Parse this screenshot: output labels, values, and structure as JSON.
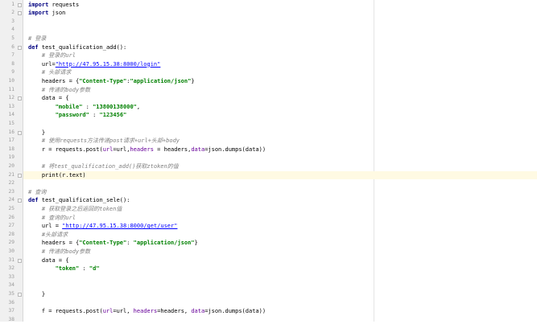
{
  "editor": {
    "language": "python",
    "current_line": 21,
    "colors": {
      "keyword": "#000080",
      "comment": "#808080",
      "string": "#008000",
      "url": "#0000ff",
      "param": "#660099",
      "highlight": "#fffae3"
    },
    "lines": [
      {
        "n": 1,
        "fold": true,
        "tokens": [
          {
            "t": "kw",
            "v": "import"
          },
          {
            "t": "p",
            "v": " requests"
          }
        ]
      },
      {
        "n": 2,
        "fold": true,
        "tokens": [
          {
            "t": "kw",
            "v": "import"
          },
          {
            "t": "p",
            "v": " json"
          }
        ]
      },
      {
        "n": 3,
        "tokens": []
      },
      {
        "n": 4,
        "tokens": []
      },
      {
        "n": 5,
        "tokens": [
          {
            "t": "cm",
            "v": "# 登录"
          }
        ]
      },
      {
        "n": 6,
        "fold": true,
        "tokens": [
          {
            "t": "kw",
            "v": "def"
          },
          {
            "t": "p",
            "v": " test_qualification_add():"
          }
        ]
      },
      {
        "n": 7,
        "tokens": [
          {
            "t": "p",
            "v": "    "
          },
          {
            "t": "cm",
            "v": "# 登录的url"
          }
        ]
      },
      {
        "n": 8,
        "tokens": [
          {
            "t": "p",
            "v": "    url="
          },
          {
            "t": "url",
            "v": "\"http://47.95.15.38:8000/login\""
          }
        ]
      },
      {
        "n": 9,
        "tokens": [
          {
            "t": "p",
            "v": "    "
          },
          {
            "t": "cm",
            "v": "# 头部请求"
          }
        ]
      },
      {
        "n": 10,
        "tokens": [
          {
            "t": "p",
            "v": "    headers = {"
          },
          {
            "t": "st",
            "v": "\"Content-Type\""
          },
          {
            "t": "p",
            "v": ":"
          },
          {
            "t": "st",
            "v": "\"application/json\""
          },
          {
            "t": "p",
            "v": "}"
          }
        ]
      },
      {
        "n": 11,
        "tokens": [
          {
            "t": "p",
            "v": "    "
          },
          {
            "t": "cm",
            "v": "# 传递的body参数"
          }
        ]
      },
      {
        "n": 12,
        "fold": true,
        "tokens": [
          {
            "t": "p",
            "v": "    data = {"
          }
        ]
      },
      {
        "n": 13,
        "tokens": [
          {
            "t": "p",
            "v": "        "
          },
          {
            "t": "st",
            "v": "\"mobile\""
          },
          {
            "t": "p",
            "v": " : "
          },
          {
            "t": "st",
            "v": "\"13800138000\""
          },
          {
            "t": "p",
            "v": ","
          }
        ]
      },
      {
        "n": 14,
        "tokens": [
          {
            "t": "p",
            "v": "        "
          },
          {
            "t": "st",
            "v": "\"password\""
          },
          {
            "t": "p",
            "v": " : "
          },
          {
            "t": "st",
            "v": "\"123456\""
          }
        ]
      },
      {
        "n": 15,
        "tokens": []
      },
      {
        "n": 16,
        "fold": true,
        "tokens": [
          {
            "t": "p",
            "v": "    }"
          }
        ]
      },
      {
        "n": 17,
        "tokens": [
          {
            "t": "p",
            "v": "    "
          },
          {
            "t": "cm",
            "v": "# 使用requests方法传递post请求+url+头部+body"
          }
        ]
      },
      {
        "n": 18,
        "tokens": [
          {
            "t": "p",
            "v": "    r = requests.post("
          },
          {
            "t": "pm",
            "v": "url"
          },
          {
            "t": "p",
            "v": "=url,"
          },
          {
            "t": "pm",
            "v": "headers"
          },
          {
            "t": "p",
            "v": " = headers,"
          },
          {
            "t": "pm",
            "v": "data"
          },
          {
            "t": "p",
            "v": "=json.dumps(data))"
          }
        ]
      },
      {
        "n": 19,
        "tokens": []
      },
      {
        "n": 20,
        "tokens": [
          {
            "t": "p",
            "v": "    "
          },
          {
            "t": "cm",
            "v": "# 将test_qualification_add()获取ztoken的值"
          }
        ]
      },
      {
        "n": 21,
        "fold": true,
        "tokens": [
          {
            "t": "p",
            "v": "    print(r.text)"
          }
        ]
      },
      {
        "n": 22,
        "tokens": []
      },
      {
        "n": 23,
        "tokens": [
          {
            "t": "cm",
            "v": "# 查询"
          }
        ]
      },
      {
        "n": 24,
        "fold": true,
        "tokens": [
          {
            "t": "kw",
            "v": "def"
          },
          {
            "t": "p",
            "v": " test_qualification_sele():"
          }
        ]
      },
      {
        "n": 25,
        "tokens": [
          {
            "t": "p",
            "v": "    "
          },
          {
            "t": "cm",
            "v": "# 获取登录之后返回的token值"
          }
        ]
      },
      {
        "n": 26,
        "tokens": [
          {
            "t": "p",
            "v": "    "
          },
          {
            "t": "cm",
            "v": "# 查询的url"
          }
        ]
      },
      {
        "n": 27,
        "tokens": [
          {
            "t": "p",
            "v": "    url = "
          },
          {
            "t": "url",
            "v": "\"http://47.95.15.38:8000/get/user\""
          }
        ]
      },
      {
        "n": 28,
        "tokens": [
          {
            "t": "p",
            "v": "    "
          },
          {
            "t": "cm",
            "v": "#头部请求"
          }
        ]
      },
      {
        "n": 29,
        "tokens": [
          {
            "t": "p",
            "v": "    headers = {"
          },
          {
            "t": "st",
            "v": "\"Content-Type\""
          },
          {
            "t": "p",
            "v": ": "
          },
          {
            "t": "st",
            "v": "\"application/json\""
          },
          {
            "t": "p",
            "v": "}"
          }
        ]
      },
      {
        "n": 30,
        "tokens": [
          {
            "t": "p",
            "v": "    "
          },
          {
            "t": "cm",
            "v": "# 传递的body参数"
          }
        ]
      },
      {
        "n": 31,
        "fold": true,
        "tokens": [
          {
            "t": "p",
            "v": "    data = {"
          }
        ]
      },
      {
        "n": 32,
        "tokens": [
          {
            "t": "p",
            "v": "        "
          },
          {
            "t": "st",
            "v": "\"token\""
          },
          {
            "t": "p",
            "v": " : "
          },
          {
            "t": "st",
            "v": "\"d\""
          }
        ]
      },
      {
        "n": 33,
        "tokens": []
      },
      {
        "n": 34,
        "tokens": []
      },
      {
        "n": 35,
        "fold": true,
        "tokens": [
          {
            "t": "p",
            "v": "    }"
          }
        ]
      },
      {
        "n": 36,
        "tokens": []
      },
      {
        "n": 37,
        "tokens": [
          {
            "t": "p",
            "v": "    f = requests.post("
          },
          {
            "t": "pm",
            "v": "url"
          },
          {
            "t": "p",
            "v": "=url, "
          },
          {
            "t": "pm",
            "v": "headers"
          },
          {
            "t": "p",
            "v": "=headers, "
          },
          {
            "t": "pm",
            "v": "data"
          },
          {
            "t": "p",
            "v": "=json.dumps(data))"
          }
        ]
      },
      {
        "n": 38,
        "tokens": []
      }
    ]
  }
}
